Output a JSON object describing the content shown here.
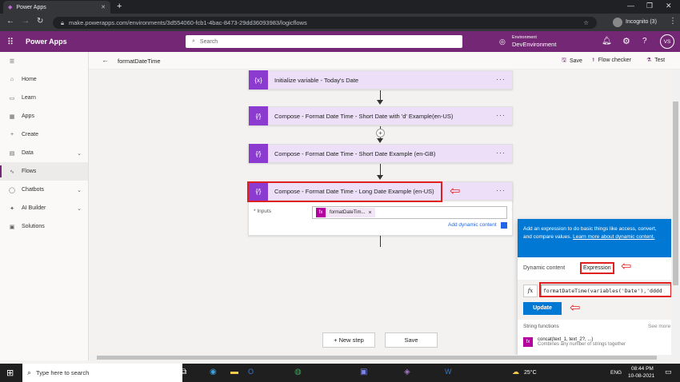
{
  "browser": {
    "tab_title": "Power Apps",
    "new_tab": "+",
    "url": "make.powerapps.com/environments/3d554060-fcb1-4bac-8473-29dd36093983/logicflows",
    "incognito_label": "Incognito (3)"
  },
  "appbar": {
    "app_name": "Power Apps",
    "search_placeholder": "Search",
    "env_label": "Environment",
    "env_name": "DevEnvironment",
    "avatar": "VS"
  },
  "sidebar": {
    "items": [
      {
        "label": "Home",
        "icon": "⌂"
      },
      {
        "label": "Learn",
        "icon": "▭"
      },
      {
        "label": "Apps",
        "icon": "▦"
      },
      {
        "label": "Create",
        "icon": "+"
      },
      {
        "label": "Data",
        "icon": "▤"
      },
      {
        "label": "Flows",
        "icon": "∿"
      },
      {
        "label": "Chatbots",
        "icon": "◯"
      },
      {
        "label": "AI Builder",
        "icon": "✦"
      },
      {
        "label": "Solutions",
        "icon": "▣"
      }
    ]
  },
  "command_bar": {
    "flow_name": "formatDateTime",
    "save": "Save",
    "flow_checker": "Flow checker",
    "test": "Test"
  },
  "flow": {
    "steps": [
      {
        "title": "Initialize variable - Today's Date",
        "icon": "{x}"
      },
      {
        "title": "Compose - Format Date Time - Short Date with 'd' Example(en-US)",
        "icon": "{⁄}"
      },
      {
        "title": "Compose - Format Date Time - Short Date Example (en-GB)",
        "icon": "{⁄}"
      },
      {
        "title": "Compose - Format Date Time - Long Date Example (en-US)",
        "icon": "{⁄}"
      }
    ],
    "inputs_label": "* Inputs",
    "token_label": "formatDateTim...",
    "token_close": "×",
    "add_dynamic": "Add dynamic content",
    "new_step": "+ New step",
    "save_btn": "Save"
  },
  "expression_panel": {
    "info_text": "Add an expression to do basic things like access, convert, and compare values.",
    "learn_more": "Learn more about dynamic content.",
    "tab_dynamic": "Dynamic content",
    "tab_expression": "Expression",
    "fx": "fx",
    "expression_value": "formatDateTime(variables('Date'),'dddd",
    "update": "Update",
    "section": "String functions",
    "see_more": "See more",
    "func_name": "concat(text_1, text_2?, ...)",
    "func_desc": "Combines any number of strings together"
  },
  "taskbar": {
    "search": "Type here to search",
    "temp": "25°C",
    "lang": "ENG",
    "time": "08:44 PM",
    "date": "10-08-2021"
  }
}
